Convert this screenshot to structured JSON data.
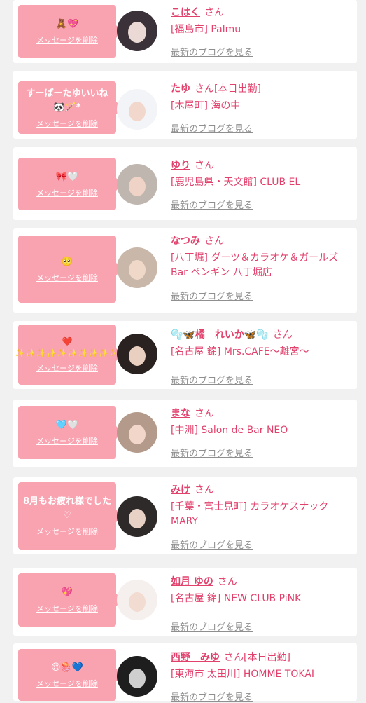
{
  "delete_label": "メッセージを削除",
  "san_label": "さん",
  "blog_label": "最新のブログを見る",
  "colors": {
    "bubble": "#f9a2b0",
    "name": "#e2416c",
    "link_gray": "#8f8f8f"
  },
  "items": [
    {
      "message": "🧸💖",
      "name": "こはく",
      "status": "",
      "shop": "[福島市] Palmu"
    },
    {
      "message": "すーぱーたゆいいね🐼🪄*",
      "name": "たゆ",
      "status": "[本日出勤]",
      "shop": "[木屋町] 海の中"
    },
    {
      "message": "🎀🤍",
      "name": "ゆり",
      "status": "",
      "shop": "[鹿児島県・天文館] CLUB EL"
    },
    {
      "message": "🥺",
      "name": "なつみ",
      "status": "",
      "shop": "[八丁堀] ダーツ＆カラオケ＆ガールズBar ペンギン 八丁堀店"
    },
    {
      "message": "❤️ ✨✨✨✨✨✨✨✨✨✨",
      "name": "🫧🦋橘　れいか🦋🫧",
      "status": "",
      "shop": "[名古屋 錦] Mrs.CAFE〜離宮〜"
    },
    {
      "message": "🩵🤍",
      "name": "まな",
      "status": "",
      "shop": "[中洲] Salon de Bar NEO"
    },
    {
      "message": "8月もお疲れ様でした♡",
      "name": "みけ",
      "status": "",
      "shop": "[千葉・富士見町] カラオケスナックMARY"
    },
    {
      "message": "💖",
      "name": "如月 ゆの",
      "status": "",
      "shop": "[名古屋 錦] NEW CLUB PiNK"
    },
    {
      "message": "😌🪼💙",
      "name": "西野　みゆ",
      "status": "[本日出勤]",
      "shop": "[東海市 太田川] HOMME TOKAI"
    }
  ]
}
